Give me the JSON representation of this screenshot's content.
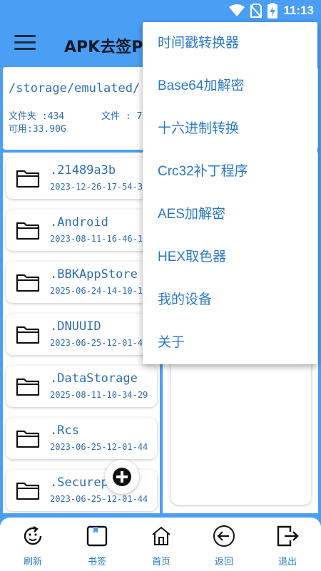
{
  "status_bar": {
    "time": "11:13"
  },
  "app_bar": {
    "title": "APK去签P"
  },
  "path_card": {
    "path": "/storage/emulated/",
    "folders_label": "文件夹 :434",
    "files_label": "文件 : 7",
    "available_label": "可用:33.90G"
  },
  "file_list": [
    {
      "name": ".21489a3b",
      "date": "2023-12-26-17-54-3"
    },
    {
      "name": ".Android",
      "date": "2023-08-11-16-46-1"
    },
    {
      "name": ".BBKAppStore",
      "date": "2025-06-24-14-10-1"
    },
    {
      "name": ".DNUUID",
      "date": "2023-06-25-12-01-4"
    },
    {
      "name": ".DataStorage",
      "date": "2025-08-11-10-34-29"
    },
    {
      "name": ".Rcs",
      "date": "2023-06-25-12-01-44"
    },
    {
      "name": ".Securep",
      "date": "2023-06-25-12-01-44"
    }
  ],
  "popup_menu": [
    "时间戳转换器",
    "Base64加解密",
    "十六进制转换",
    "Crc32补丁程序",
    "AES加解密",
    "HEX取色器",
    "我的设备",
    "关于"
  ],
  "bottom_nav": [
    {
      "label": "刷新",
      "icon": "refresh-icon"
    },
    {
      "label": "书签",
      "icon": "bookmark-icon"
    },
    {
      "label": "首页",
      "icon": "home-icon"
    },
    {
      "label": "返回",
      "icon": "back-icon"
    },
    {
      "label": "退出",
      "icon": "exit-icon"
    }
  ],
  "colors": {
    "primary": "#4a9ff5",
    "text_blue": "#2d6db5",
    "menu_text": "#2a79c9"
  }
}
